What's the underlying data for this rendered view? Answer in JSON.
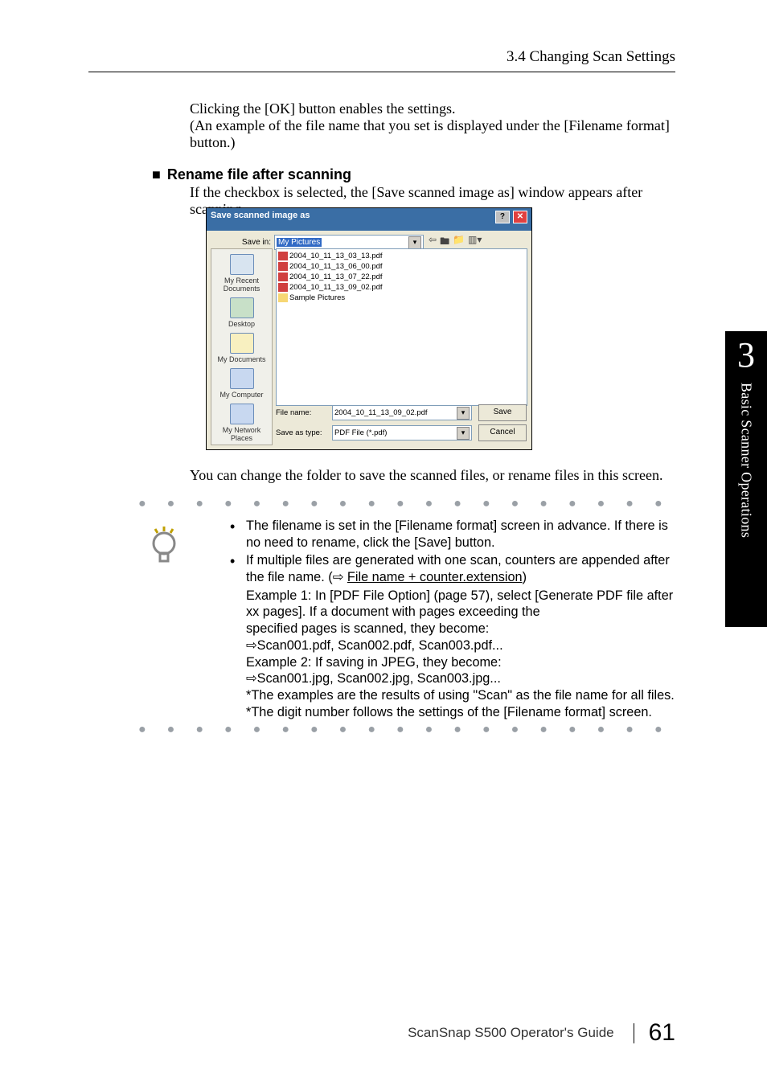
{
  "header": {
    "section_title": "3.4 Changing Scan Settings"
  },
  "p1": {
    "l1": "Clicking the [OK] button enables the settings.",
    "l2": "(An example of the file name that you set is displayed under the [Filename format] button.)"
  },
  "section2": {
    "marker": "■",
    "title": "Rename file after scanning"
  },
  "p2": "If the checkbox is selected, the [Save scanned image as] window appears after scanning.",
  "dialog": {
    "title": "Save scanned image as",
    "save_in_label": "Save in:",
    "save_in_value": "My Pictures",
    "places": {
      "recent": "My Recent Documents",
      "desktop": "Desktop",
      "mydocs": "My Documents",
      "mycomp": "My Computer",
      "network": "My Network Places"
    },
    "files": {
      "f1": "2004_10_11_13_03_13.pdf",
      "f2": "2004_10_11_13_06_00.pdf",
      "f3": "2004_10_11_13_07_22.pdf",
      "f4": "2004_10_11_13_09_02.pdf",
      "folder": "Sample Pictures"
    },
    "filename_label": "File name:",
    "filename_value": "2004_10_11_13_09_02.pdf",
    "savetype_label": "Save as type:",
    "savetype_value": "PDF File (*.pdf)",
    "save_btn": "Save",
    "cancel_btn": "Cancel"
  },
  "p3": "You can change the folder to save the scanned files, or rename files in this screen.",
  "tip": {
    "b1": "The filename is set in the [Filename format] screen in advance. If there is no need to rename, click the [Save] button.",
    "b2a": "If multiple files are generated with one scan, counters are appended after the file name. (",
    "b2_arrow": "⇨",
    "b2_link": "File name + counter.extension",
    "b2b": ")",
    "ex1": "Example 1: In [PDF File Option] (page 57), select [Generate PDF file after xx pages]. If a document with pages exceeding the",
    "ex1b": "specified pages is scanned, they become:",
    "ex1c": "⇨Scan001.pdf, Scan002.pdf, Scan003.pdf...",
    "ex2": "Example 2: If saving in JPEG, they become:",
    "ex2b": "⇨Scan001.jpg, Scan002.jpg, Scan003.jpg...",
    "note1": "*The examples are the results of using \"Scan\" as the file name for all files.",
    "note2": "*The digit number follows the settings of the [Filename format] screen."
  },
  "side": {
    "chapter_num": "3",
    "chapter_title": "Basic Scanner Operations"
  },
  "footer": {
    "guide": "ScanSnap S500 Operator's Guide",
    "page": "61"
  }
}
